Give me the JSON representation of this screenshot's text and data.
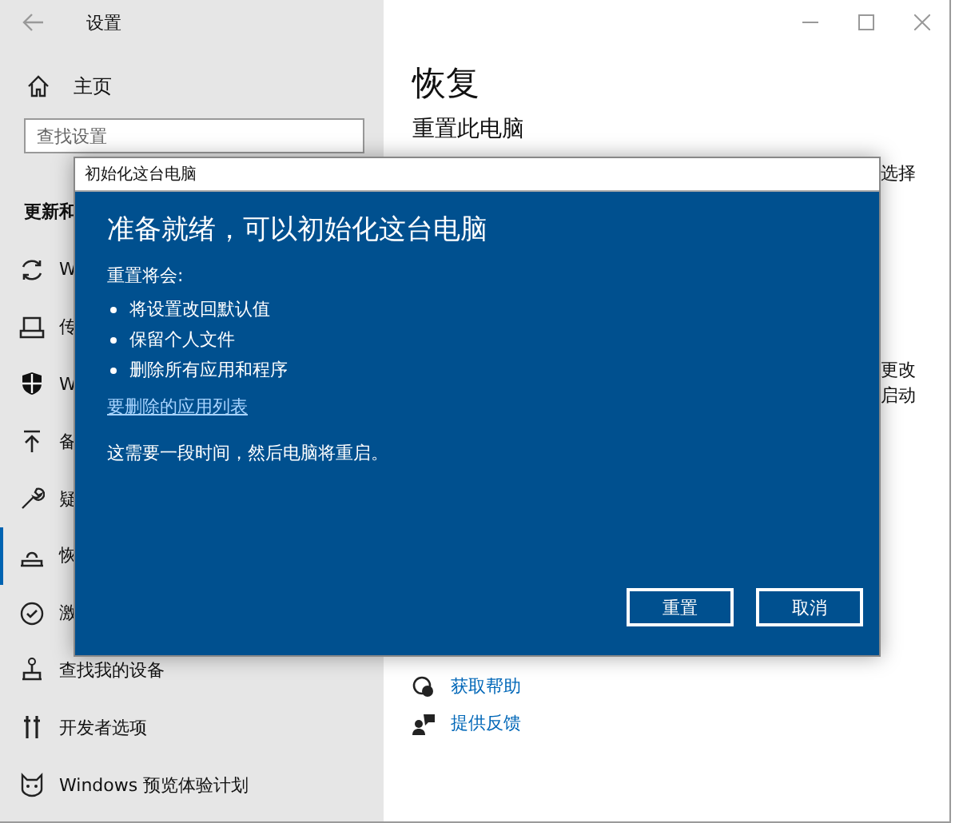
{
  "window": {
    "title": "设置"
  },
  "sidebar": {
    "home": "主页",
    "search": {
      "placeholder": "查找设置"
    },
    "section": "更新和",
    "items": [
      {
        "label": "W",
        "selected": false
      },
      {
        "label": "传",
        "selected": false
      },
      {
        "label": "W",
        "selected": false
      },
      {
        "label": "备",
        "selected": false
      },
      {
        "label": "疑",
        "selected": false
      },
      {
        "label": "恢",
        "selected": true
      },
      {
        "label": "激",
        "selected": false
      },
      {
        "label": "查找我的设备",
        "selected": false
      },
      {
        "label": "开发者选项",
        "selected": false
      },
      {
        "label": "Windows 预览体验计划",
        "selected": false
      }
    ]
  },
  "content": {
    "heading": "恢复",
    "subheading": "重置此电脑",
    "fragments": [
      "选择",
      "更改",
      "启动"
    ],
    "links": [
      "获取帮助",
      "提供反馈"
    ]
  },
  "dialog": {
    "title": "初始化这台电脑",
    "heading": "准备就绪，可以初始化这台电脑",
    "intro": "重置将会:",
    "bullets": [
      "将设置改回默认值",
      "保留个人文件",
      "删除所有应用和程序"
    ],
    "link": "要删除的应用列表",
    "note": "这需要一段时间，然后电脑将重启。",
    "buttons": [
      "重置",
      "取消"
    ]
  }
}
